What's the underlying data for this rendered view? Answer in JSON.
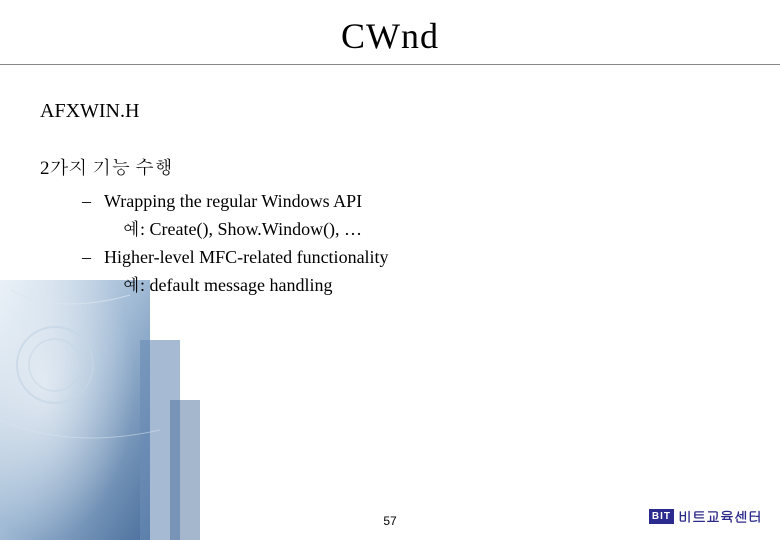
{
  "title": "CWnd",
  "header_file": "AFXWIN.H",
  "section_heading": "2가지 기능 수행",
  "bullets": [
    {
      "text": "Wrapping the regular Windows API",
      "example": "예: Create(), Show.Window(), …"
    },
    {
      "text": "Higher-level MFC-related functionality",
      "example": "예: default message handling"
    }
  ],
  "page_number": "57",
  "footer_logo_text": "BIT",
  "footer_text": "비트교육센터"
}
